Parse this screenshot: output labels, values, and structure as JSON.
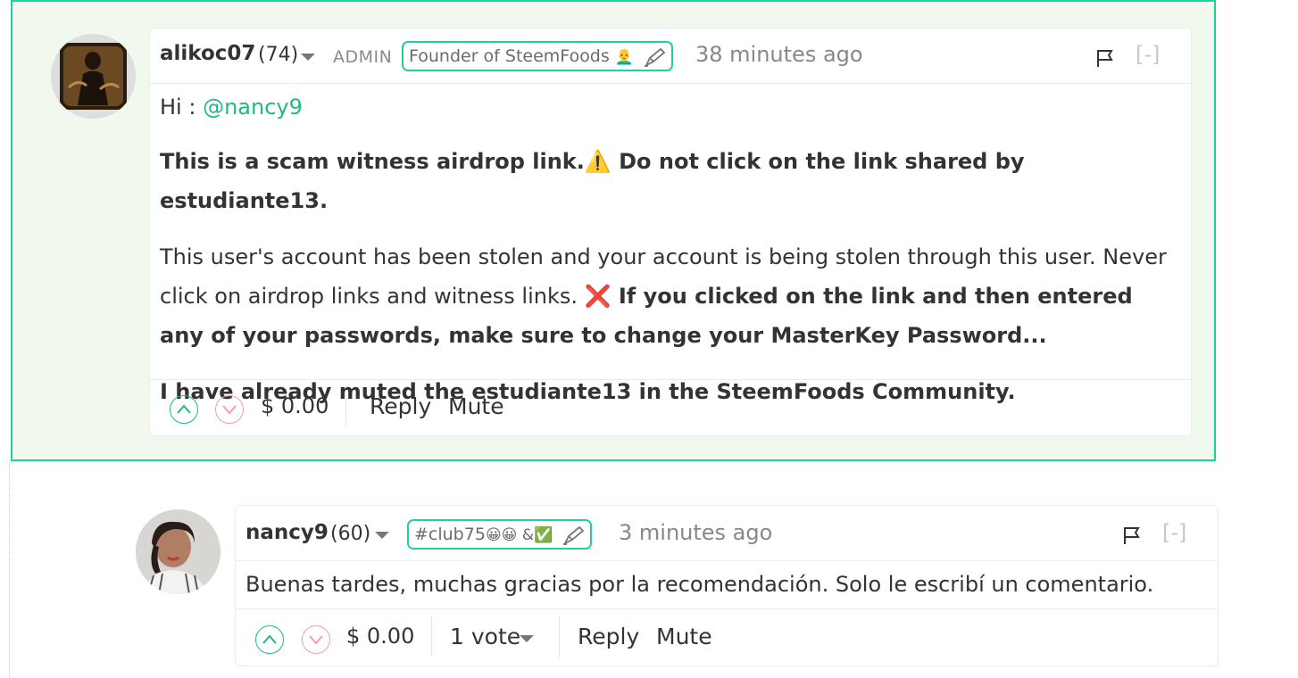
{
  "comments": [
    {
      "author": "alikoc07",
      "reputation": "(74)",
      "role": "ADMIN",
      "badge": "Founder of SteemFoods",
      "badge_emoji": "👨‍🦲",
      "time": "38 minutes ago",
      "collapse": "[-]",
      "greeting": "Hi : ",
      "mention": "@nancy9",
      "p1": "This is a scam witness airdrop link.",
      "p1_warn": "⚠️",
      "p1_rest": " Do not click on the link shared by estudiante13.",
      "p2": "This user's account has been stolen and your account is being stolen through this user. Never click on airdrop links and witness links. ",
      "p2_x": "❌",
      "p2_bold": " If you clicked on the link and then entered any of your passwords, make sure to change your MasterKey Password...",
      "p3": "I have already muted the estudiante13 in the SteemFoods Community.",
      "payout": "$ 0.00",
      "reply": "Reply",
      "mute": "Mute"
    },
    {
      "author": "nancy9",
      "reputation": "(60)",
      "badge": "#club75",
      "badge_emojis": "😀😀 &✅",
      "time": "3 minutes ago",
      "collapse": "[-]",
      "body": "Buenas tardes, muchas gracias por la recomendación. Solo le escribí un comentario.",
      "payout": "$ 0.00",
      "votes": "1 vote",
      "reply": "Reply",
      "mute": "Mute"
    }
  ],
  "colors": {
    "accent": "#1fd1a1",
    "highlight_bg": "#f1f8ee",
    "upvote": "#1fb887",
    "downvote": "#f0a0a0"
  },
  "icons": [
    "caret-down-icon",
    "pencil-icon",
    "flag-icon",
    "upvote-icon",
    "downvote-icon"
  ]
}
